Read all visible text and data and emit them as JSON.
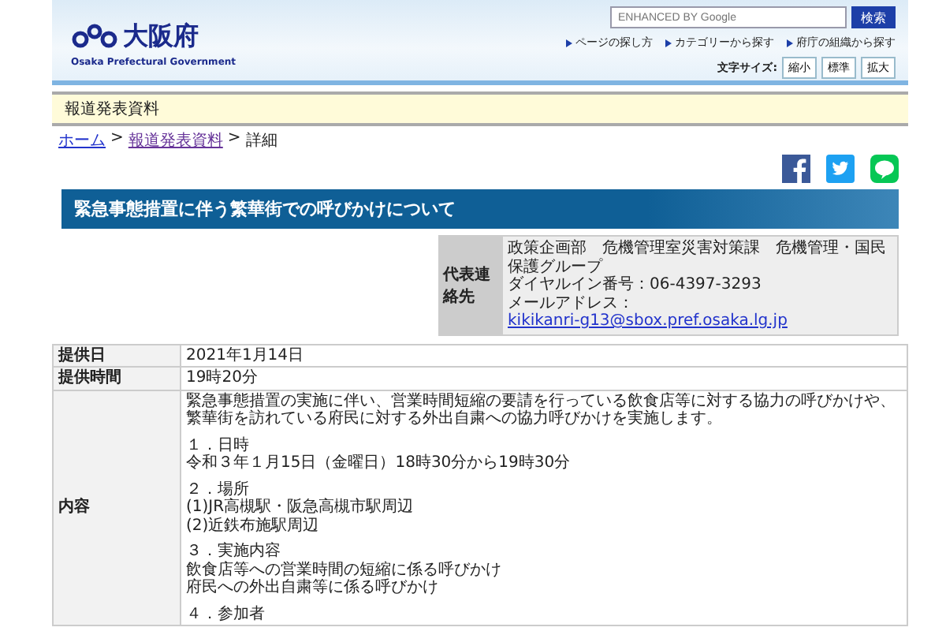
{
  "header": {
    "logo_text": "大阪府",
    "logo_subtitle": "Osaka Prefectural Government",
    "search": {
      "placeholder": "ENHANCED BY Google"
    },
    "search_button": "検索",
    "nav_links": [
      "ページの探し方",
      "カテゴリーから探す",
      "府庁の組織から探す"
    ],
    "font_size": {
      "label": "文字サイズ:",
      "buttons": [
        "縮小",
        "標準",
        "拡大"
      ]
    }
  },
  "section_band": "報道発表資料",
  "breadcrumb": [
    {
      "label": "ホーム",
      "kind": "link",
      "separator": ">"
    },
    {
      "label": "報道発表資料",
      "kind": "visited",
      "separator": ">"
    },
    {
      "label": "詳細",
      "kind": "current"
    }
  ],
  "title": "緊急事態措置に伴う繁華街での呼びかけについて",
  "contact": {
    "label": "代表連絡先",
    "lines": [
      "政策企画部　危機管理室災害対策課　危機管理・国民保護グループ",
      "ダイヤルイン番号：06-4397-3293"
    ],
    "email_label": "メールアドレス：",
    "email": "kikikanri-g13@sbox.pref.osaka.lg.jp"
  },
  "table": {
    "rows": [
      {
        "label": "提供日",
        "value": "2021年1月14日"
      },
      {
        "label": "提供時間",
        "value": "19時20分"
      },
      {
        "label": "内容",
        "intro": "緊急事態措置の実施に伴い、営業時間短縮の要請を行っている飲食店等に対する協力の呼びかけや、繁華街を訪れている府民に対する外出自粛への協力呼びかけを実施します。",
        "sections": [
          {
            "heading": "１．日時",
            "lines": [
              "令和３年１月15日（金曜日）18時30分から19時30分"
            ]
          },
          {
            "heading": "２．場所",
            "lines": [
              "(1)JR高槻駅・阪急高槻市駅周辺",
              "(2)近鉄布施駅周辺"
            ]
          },
          {
            "heading": "３．実施内容",
            "lines": [
              "飲食店等への営業時間の短縮に係る呼びかけ",
              "府民への外出自粛等に係る呼びかけ"
            ]
          },
          {
            "heading": "４．参加者"
          }
        ]
      }
    ]
  }
}
